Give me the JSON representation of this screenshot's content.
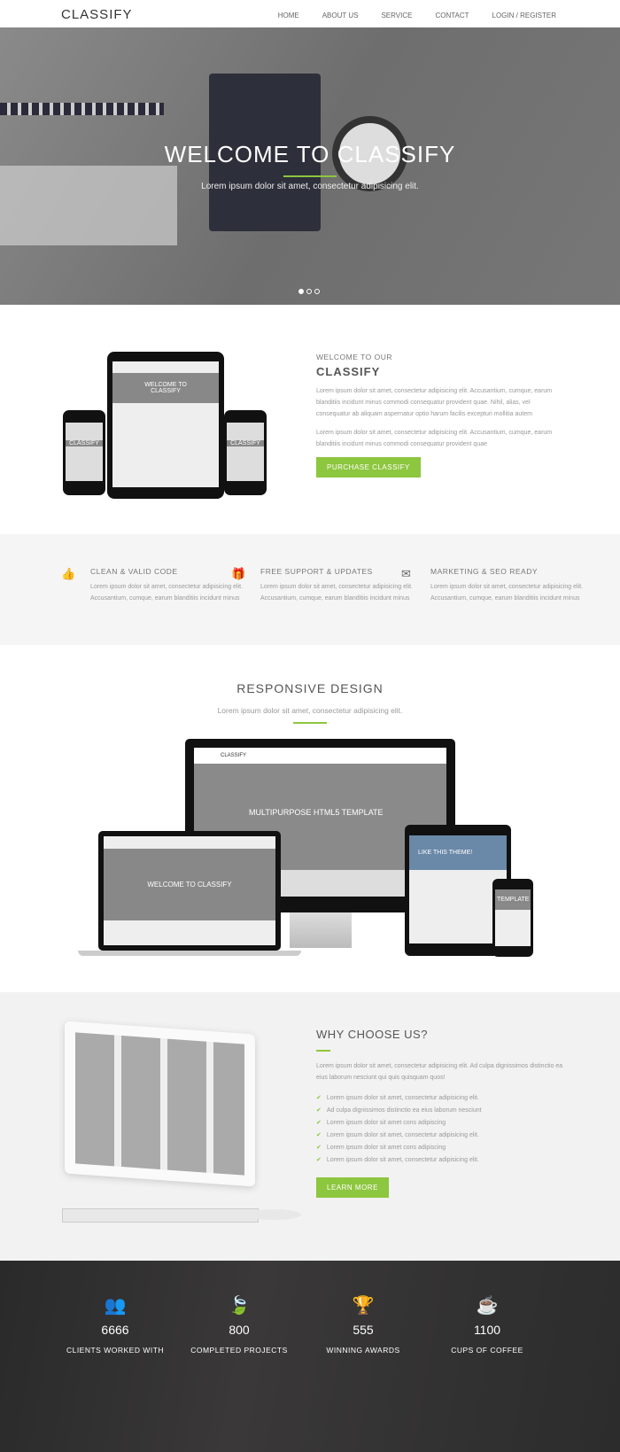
{
  "nav": {
    "logo": "CLASSIFY",
    "items": [
      "HOME",
      "ABOUT US",
      "SERVICE",
      "CONTACT",
      "LOGIN / REGISTER"
    ]
  },
  "hero": {
    "title": "WELCOME TO CLASSIFY",
    "subtitle": "Lorem ipsum dolor sit amet, consectetur adipisicing elit.",
    "slides": 3,
    "active_slide": 1
  },
  "welcome": {
    "kicker": "WELCOME TO OUR",
    "title": "CLASSIFY",
    "p1": "Lorem ipsum dolor sit amet, consectetur adipisicing elit. Accusantium, cumque, earum blanditiis incidunt minus commodi consequatur provident quae. Nihil, alias, vel consequatur ab aliquam aspernatur optio harum facilis excepturi mollitia autem",
    "p2": "Lorem ipsum dolor sit amet, consectetur adipisicing elit. Accusantium, cumque, earum blanditiis incidunt minus commodi consequatur provident quae",
    "button": "PURCHASE CLASSIFY",
    "mock_text": "WELCOME TO CLASSIFY",
    "mock_small": "CLASSIFY"
  },
  "features": [
    {
      "icon": "thumbs-up-icon",
      "glyph": "👍",
      "title": "CLEAN & VALID CODE",
      "text": "Lorem ipsum dolor sit amet, consectetur adipisicing elit. Accusantium, cumque, earum blanditiis incidunt minus"
    },
    {
      "icon": "gift-icon",
      "glyph": "🎁",
      "title": "FREE SUPPORT & UPDATES",
      "text": "Lorem ipsum dolor sit amet, consectetur adipisicing elit. Accusantium, cumque, earum blanditiis incidunt minus"
    },
    {
      "icon": "envelope-icon",
      "glyph": "✉",
      "title": "MARKETING & SEO READY",
      "text": "Lorem ipsum dolor sit amet, consectetur adipisicing elit. Accusantium, cumque, earum blanditiis incidunt minus"
    }
  ],
  "responsive": {
    "title": "RESPONSIVE DESIGN",
    "subtitle": "Lorem ipsum dolor sit amet, consectetur adipisicing elit.",
    "monitor_text": "MULTIPURPOSE HTML5 TEMPLATE",
    "laptop_text": "WELCOME TO CLASSIFY",
    "tablet_text": "LIKE THIS THEME!",
    "phone_text": "TEMPLATE",
    "mock_logo": "CLASSIFY"
  },
  "why": {
    "title": "WHY CHOOSE US?",
    "text": "Lorem ipsum dolor sit amet, consectetur adipisicing elit. Ad culpa dignissimos distinctio ea eius laborum nesciunt qui quis quisquam quos!",
    "items": [
      "Lorem ipsum dolor sit amet, consectetur adipisicing elit.",
      "Ad culpa dignissimos distinctio ea eius laborum nesciunt",
      "Lorem ipsum dolor sit amet cons adipiscing",
      "Lorem ipsum dolor sit amet, consectetur adipisicing elit.",
      "Lorem ipsum dolor sit amet cons adipiscing",
      "Lorem ipsum dolor sit amet, consectetur adipisicing elit."
    ],
    "button": "LEARN MORE"
  },
  "stats": [
    {
      "icon": "users-icon",
      "glyph": "👥",
      "number": "6666",
      "label": "CLIENTS WORKED WITH"
    },
    {
      "icon": "leaf-icon",
      "glyph": "🍃",
      "number": "800",
      "label": "COMPLETED PROJECTS"
    },
    {
      "icon": "trophy-icon",
      "glyph": "🏆",
      "number": "555",
      "label": "WINNING AWARDS"
    },
    {
      "icon": "coffee-icon",
      "glyph": "☕",
      "number": "1100",
      "label": "CUPS OF COFFEE"
    }
  ],
  "colors": {
    "accent": "#8dc63f",
    "dark": "#2b2b2b",
    "light_bg": "#f4f4f4"
  }
}
